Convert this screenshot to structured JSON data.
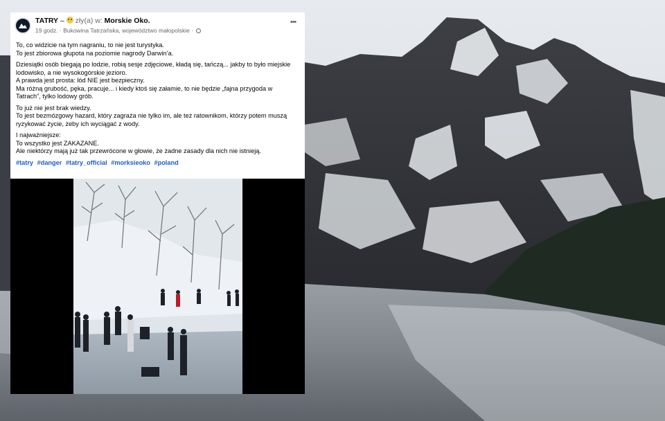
{
  "post": {
    "page_name": "TATRY",
    "feeling_prefix": " – ",
    "feeling": " zły(a) w: ",
    "location_title": "Morskie Oko.",
    "time": "19 godz.",
    "separator": " · ",
    "place": "Bukowina Tatrzańska, województwo małopolskie",
    "separator2": " · ",
    "more_label": "•••",
    "paragraphs": [
      [
        "To, co widzicie na tym nagraniu, to nie jest turystyka.",
        "To jest zbiorowa głupota na poziomie nagrody Darwin’a."
      ],
      [
        "Dziesiątki osób biegają po lodzie, robią sesje zdjęciowe, kładą się, tańczą... jakby to było miejskie lodowisko, a nie wysokogórskie jezioro.",
        "A prawda jest prosta: lód NIE jest bezpieczny.",
        "Ma różną grubość, pęka, pracuje... i kiedy ktoś się załamie, to nie będzie „fajna przygoda w Tatrach”, tylko lodowy grób."
      ],
      [
        "To już nie jest brak wiedzy.",
        "To jest bezmózgowy hazard, który zagraża nie tylko im, ale też ratownikom, którzy potem muszą ryzykować życie, żeby ich wyciągać z wody."
      ],
      [
        "I najważniejsze:",
        "To wszystko jest ZAKAZANE.",
        "Ale niektórzy mają już tak przewrócone w głowie, że żadne zasady dla nich nie istnieją."
      ]
    ],
    "hashtags": [
      "#tatry",
      "#danger",
      "#tatry_official",
      "#morksieoko",
      "#poland"
    ]
  },
  "icons": {
    "avatar": "mountain-logo-icon",
    "emoji": "angry-face-icon",
    "privacy": "globe-icon",
    "menu": "more-horizontal-icon"
  },
  "colors": {
    "hashtag": "#1c5dc4",
    "muted": "#65676b",
    "card": "#ffffff"
  }
}
